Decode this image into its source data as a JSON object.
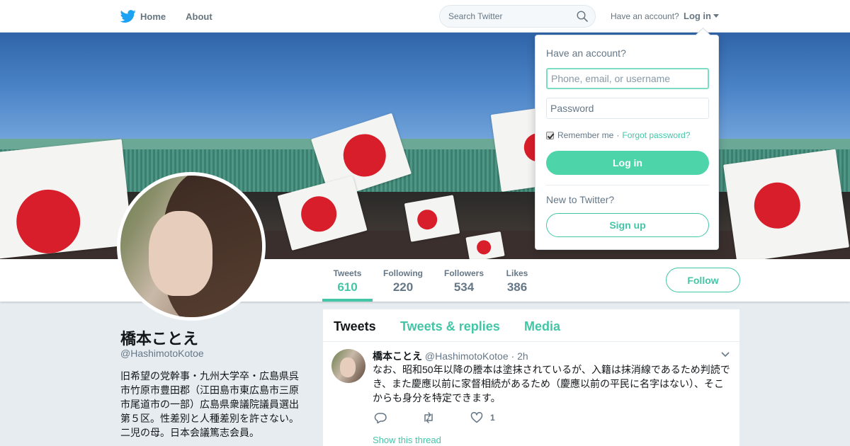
{
  "nav": {
    "home_label": "Home",
    "about_label": "About",
    "search_placeholder": "Search Twitter",
    "have_account": "Have an account?",
    "login_label": "Log in"
  },
  "login_dropdown": {
    "title": "Have an account?",
    "username_placeholder": "Phone, email, or username",
    "password_placeholder": "Password",
    "remember_label": "Remember me",
    "separator": "·",
    "forgot_label": "Forgot password?",
    "login_button": "Log in",
    "new_label": "New to Twitter?",
    "signup_button": "Sign up"
  },
  "profile": {
    "name": "橋本ことえ",
    "handle": "@HashimotoKotoe",
    "bio": "旧希望の党幹事・九州大学卒・広島県呉市竹原市豊田郡（江田島市東広島市三原市尾道市の一部）広島県衆議院議員選出第５区。性差別と人種差別を許さない。二児の母。日本会議篤志会員。",
    "stats": [
      {
        "label": "Tweets",
        "value": "610"
      },
      {
        "label": "Following",
        "value": "220"
      },
      {
        "label": "Followers",
        "value": "534"
      },
      {
        "label": "Likes",
        "value": "386"
      }
    ],
    "follow_button": "Follow"
  },
  "timeline": {
    "tabs": [
      "Tweets",
      "Tweets & replies",
      "Media"
    ],
    "tweet": {
      "name": "橋本ことえ",
      "handle": "@HashimotoKotoe",
      "separator": "·",
      "time": "2h",
      "text": "なお、昭和50年以降の謄本は塗抹されているが、入籍は抹消線であるため判読でき、また慶應以前に家督相続があるため（慶應以前の平民に名字はない）、そこからも身分を特定できます。",
      "likes": "1",
      "show_thread": "Show this thread"
    }
  },
  "colors": {
    "accent": "#43c6a7",
    "login_button": "#4dd4a8",
    "background": "#e6ecf0"
  }
}
